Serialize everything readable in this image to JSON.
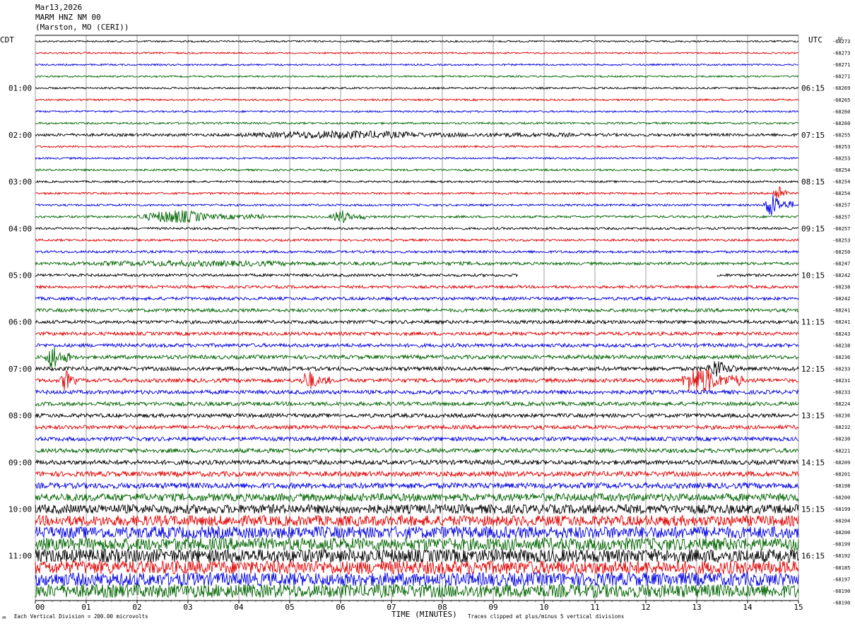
{
  "header": {
    "date": "Mar13,2026",
    "station": "MARM HNZ NM 00",
    "location": "(Marston, MO (CERI))"
  },
  "footer": {
    "scale_note": "Each Vertical Division =  200.00 microvolts",
    "clip_note": "Traces clipped at plus/minus 5 vertical divisions",
    "logo_glyph": "♒"
  },
  "chart_data": {
    "type": "line",
    "title": "",
    "xlabel": "TIME (MINUTES)",
    "x_ticks": [
      "00",
      "01",
      "02",
      "03",
      "04",
      "05",
      "06",
      "07",
      "08",
      "09",
      "10",
      "11",
      "12",
      "13",
      "14",
      "15"
    ],
    "xlim": [
      0,
      15
    ],
    "left_axis_label": "CDT",
    "right_axis_label": "UTC",
    "offset_header": "DC",
    "left_hour_labels": [
      {
        "row": 4,
        "label": "01:00"
      },
      {
        "row": 8,
        "label": "02:00"
      },
      {
        "row": 12,
        "label": "03:00"
      },
      {
        "row": 16,
        "label": "04:00"
      },
      {
        "row": 20,
        "label": "05:00"
      },
      {
        "row": 24,
        "label": "06:00"
      },
      {
        "row": 28,
        "label": "07:00"
      },
      {
        "row": 32,
        "label": "08:00"
      },
      {
        "row": 36,
        "label": "09:00"
      },
      {
        "row": 40,
        "label": "10:00"
      },
      {
        "row": 44,
        "label": "11:00"
      }
    ],
    "right_hour_labels": [
      {
        "row": 4,
        "label": "06:15"
      },
      {
        "row": 8,
        "label": "07:15"
      },
      {
        "row": 12,
        "label": "08:15"
      },
      {
        "row": 16,
        "label": "09:15"
      },
      {
        "row": 20,
        "label": "10:15"
      },
      {
        "row": 24,
        "label": "11:15"
      },
      {
        "row": 28,
        "label": "12:15"
      },
      {
        "row": 32,
        "label": "13:15"
      },
      {
        "row": 36,
        "label": "14:15"
      },
      {
        "row": 40,
        "label": "15:15"
      },
      {
        "row": 44,
        "label": "16:15"
      }
    ],
    "dc_offsets": [
      "-68273",
      "-68273",
      "-68271",
      "-68271",
      "-68269",
      "-68265",
      "-68260",
      "-68260",
      "-68255",
      "-68253",
      "-68253",
      "-68254",
      "-68254",
      "-68254",
      "-68257",
      "-68257",
      "-68257",
      "-68253",
      "-68250",
      "-68247",
      "-68242",
      "-68238",
      "-68242",
      "-68241",
      "-68241",
      "-68243",
      "-68238",
      "-68236",
      "-68233",
      "-68231",
      "-68233",
      "-68224",
      "-68236",
      "-68232",
      "-68230",
      "-68221",
      "-68209",
      "-68201",
      "-68198",
      "-68200",
      "-68199",
      "-68204",
      "-68200",
      "-68199",
      "-68192",
      "-68185",
      "-68197",
      "-68190",
      "-68190"
    ],
    "row_count": 48,
    "trace_colors": [
      "#000000",
      "#e00000",
      "#0000e0",
      "#006400"
    ],
    "noise_levels": [
      1.2,
      1.2,
      1.2,
      1.2,
      1.3,
      1.3,
      1.3,
      1.4,
      2.0,
      1.3,
      1.3,
      1.4,
      1.4,
      1.5,
      1.5,
      1.6,
      1.6,
      1.6,
      1.8,
      2.0,
      2.0,
      2.0,
      2.2,
      2.4,
      2.4,
      2.5,
      2.6,
      2.8,
      2.8,
      2.8,
      2.8,
      2.8,
      2.8,
      2.8,
      2.9,
      3.0,
      3.2,
      3.6,
      4.0,
      5.5,
      6.5,
      7.5,
      8.5,
      9.0,
      9.5,
      9.5,
      9.5,
      9.5
    ],
    "events": [
      {
        "row": 8,
        "start_min": 4.0,
        "end_min": 10.5,
        "amp_scale": 3
      },
      {
        "row": 13,
        "start_min": 14.5,
        "end_min": 14.8,
        "amp_scale": 10
      },
      {
        "row": 14,
        "start_min": 14.3,
        "end_min": 14.9,
        "amp_scale": 12
      },
      {
        "row": 15,
        "start_min": 2.0,
        "end_min": 4.5,
        "amp_scale": 6
      },
      {
        "row": 15,
        "start_min": 5.8,
        "end_min": 6.5,
        "amp_scale": 6
      },
      {
        "row": 19,
        "start_min": 0.5,
        "end_min": 9.0,
        "amp_scale": 2.2
      },
      {
        "row": 27,
        "start_min": 0.2,
        "end_min": 0.7,
        "amp_scale": 7
      },
      {
        "row": 28,
        "start_min": 13.2,
        "end_min": 13.8,
        "amp_scale": 5
      },
      {
        "row": 29,
        "start_min": 12.7,
        "end_min": 13.9,
        "amp_scale": 9
      },
      {
        "row": 29,
        "start_min": 0.5,
        "end_min": 0.8,
        "amp_scale": 6
      },
      {
        "row": 29,
        "start_min": 5.2,
        "end_min": 5.8,
        "amp_scale": 5
      }
    ],
    "gaps": [
      {
        "row": 20,
        "start_min": 9.5,
        "end_min": 13.4
      }
    ],
    "grid": true,
    "legend": "none"
  }
}
